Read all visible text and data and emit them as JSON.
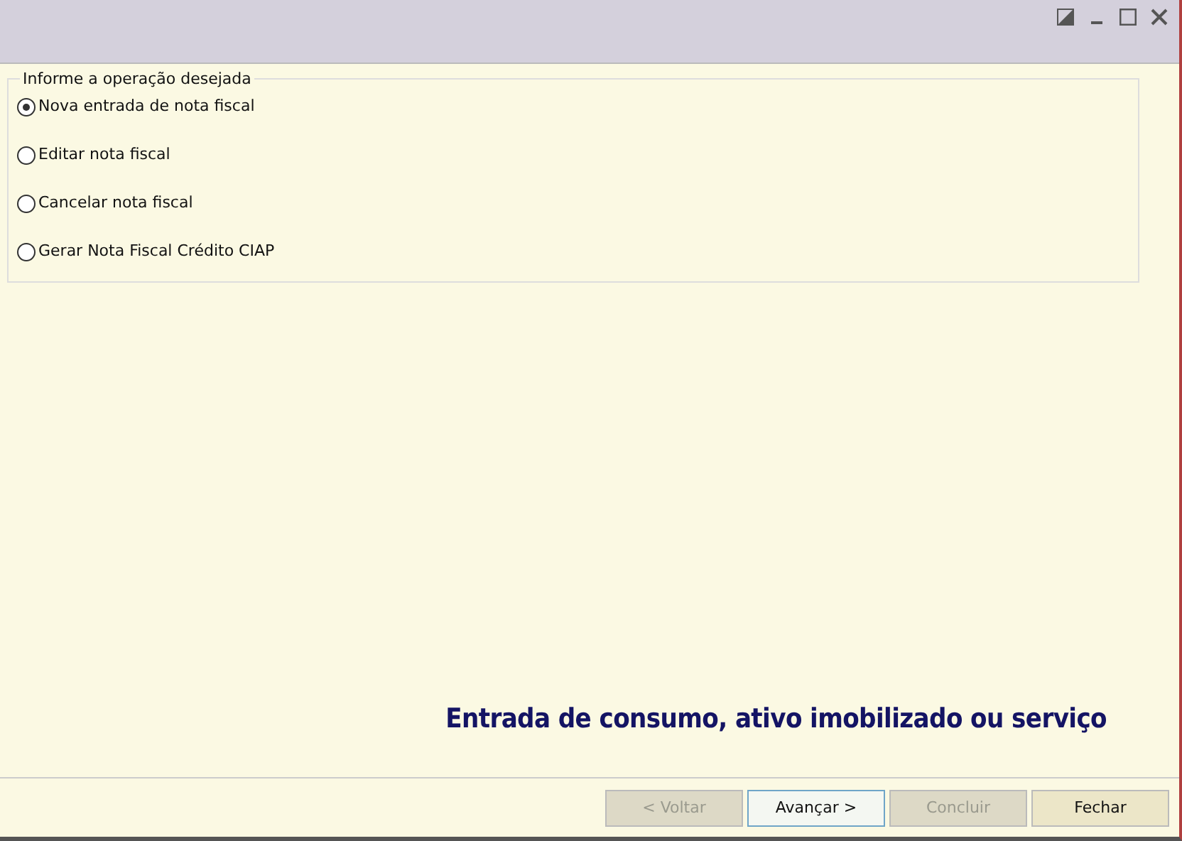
{
  "group": {
    "title": "Informe a operação desejada",
    "options": [
      {
        "label": "Nova entrada de nota fiscal",
        "selected": true
      },
      {
        "label": "Editar nota fiscal",
        "selected": false
      },
      {
        "label": "Cancelar nota fiscal",
        "selected": false
      },
      {
        "label": "Gerar Nota Fiscal Crédito CIAP",
        "selected": false
      }
    ]
  },
  "banner": "Entrada de consumo, ativo imobilizado ou serviço",
  "buttons": [
    {
      "label": "< Voltar",
      "disabled": true,
      "focused": false
    },
    {
      "label": "Avançar >",
      "disabled": false,
      "focused": true
    },
    {
      "label": "Concluir",
      "disabled": true,
      "focused": false
    },
    {
      "label": "Fechar",
      "disabled": false,
      "focused": false
    }
  ]
}
